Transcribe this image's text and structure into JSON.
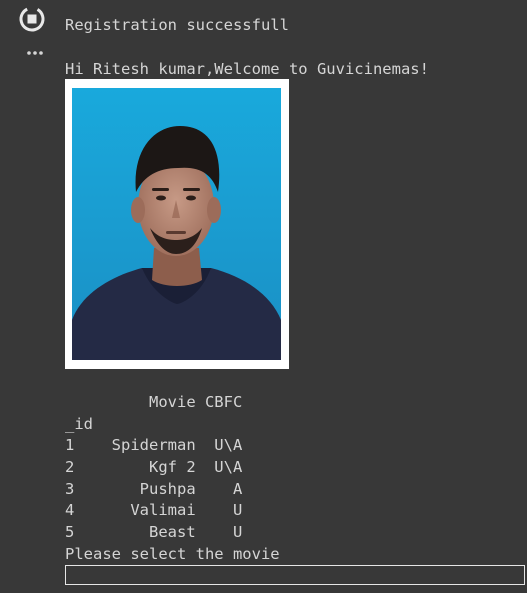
{
  "cell": {
    "run_icon": "stop-circle-icon",
    "menu_icon": "ellipsis-icon"
  },
  "output": {
    "status_message": "Registration successfull",
    "welcome_message": "Hi Ritesh kumar,Welcome to Guvicinemas!",
    "photo_icon": "user-portrait-photo",
    "table_header": "         Movie CBFC",
    "index_label": "_id",
    "rows": [
      "1    Spiderman  U\\A",
      "2        Kgf 2  U\\A",
      "3       Pushpa    A",
      "4      Valimai    U",
      "5        Beast    U"
    ],
    "prompt_text": "Please select the movie",
    "input_value": ""
  },
  "colors": {
    "background": "#383838",
    "text": "#d5d5d5",
    "photo_bg": "#1aa7d8",
    "input_border": "#e6e6e6"
  }
}
